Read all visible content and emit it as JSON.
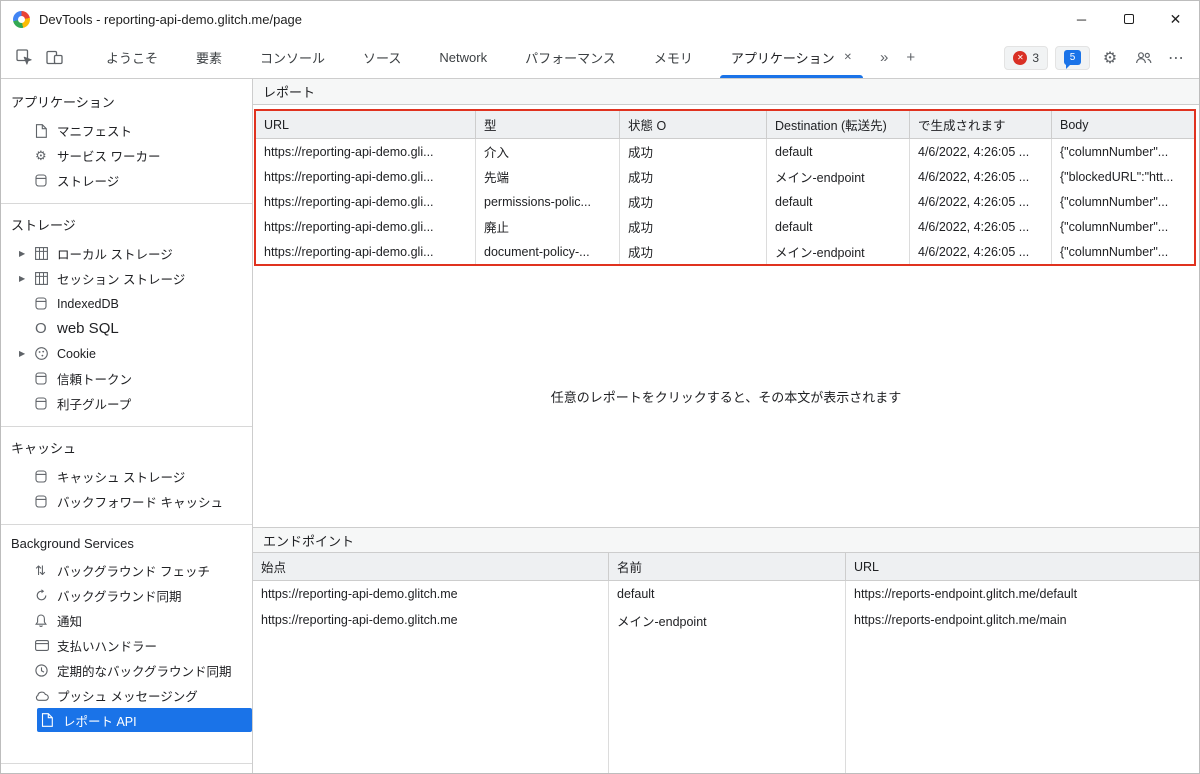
{
  "colors": {
    "selection_blue": "#1a73e8",
    "annotation_red": "#e0321f",
    "error_red": "#d93025"
  },
  "icons": {
    "expand_arrow": "▶",
    "gear": "⚙",
    "fetch": "⇅",
    "more_tabs": "»",
    "add_tab": "+",
    "overflow": "⋯",
    "tab_close": "✕",
    "minimize": "─",
    "window_close": "✕",
    "error_x": "✕",
    "web_sql_o": "O"
  },
  "titlebar": {
    "title": "DevTools - reporting-api-demo.glitch.me/page"
  },
  "toolbar": {
    "tabs": [
      {
        "label": "ようこそ"
      },
      {
        "label": "要素"
      },
      {
        "label": "コンソール"
      },
      {
        "label": "ソース"
      },
      {
        "label": "Network"
      },
      {
        "label": "パフォーマンス"
      },
      {
        "label": "メモリ"
      },
      {
        "label": "アプリケーション",
        "active": true
      }
    ],
    "error_count": "3",
    "issue_count": "5"
  },
  "sidebar": {
    "sections": [
      {
        "title": "アプリケーション",
        "items": [
          {
            "label": "マニフェスト",
            "icon": "document"
          },
          {
            "label": "サービス ワーカー",
            "icon": "gear"
          },
          {
            "label": "ストレージ",
            "icon": "storage"
          }
        ]
      },
      {
        "title": "ストレージ",
        "items": [
          {
            "label": "ローカル ストレージ",
            "icon": "table",
            "expandable": true
          },
          {
            "label": "セッション ストレージ",
            "icon": "table",
            "expandable": true
          },
          {
            "label": "IndexedDB",
            "icon": "storage"
          },
          {
            "label": "web SQL",
            "icon": "circle-o"
          },
          {
            "label": "Cookie",
            "icon": "cookie",
            "expandable": true
          },
          {
            "label": "信頼トークン",
            "icon": "storage"
          },
          {
            "label": "利子グループ",
            "icon": "storage"
          }
        ]
      },
      {
        "title": "キャッシュ",
        "items": [
          {
            "label": "キャッシュ ストレージ",
            "icon": "storage"
          },
          {
            "label": "バックフォワード キャッシュ",
            "icon": "storage"
          }
        ]
      },
      {
        "title": "Background Services",
        "items": [
          {
            "label": "バックグラウンド フェッチ",
            "icon": "fetch"
          },
          {
            "label": "バックグラウンド同期",
            "icon": "sync"
          },
          {
            "label": "通知",
            "icon": "bell"
          },
          {
            "label": "支払いハンドラー",
            "icon": "card"
          },
          {
            "label": "定期的なバックグラウンド同期",
            "icon": "clock"
          },
          {
            "label": "プッシュ メッセージング",
            "icon": "cloud"
          },
          {
            "label": "レポート API",
            "icon": "document",
            "selected": true
          }
        ]
      }
    ]
  },
  "reports": {
    "title": "レポート",
    "columns": [
      "URL",
      "型",
      "状態 O",
      "Destination (転送先)",
      "で生成されます",
      "Body"
    ],
    "rows": [
      [
        "https://reporting-api-demo.gli...",
        "介入",
        "成功",
        "default",
        "4/6/2022, 4:26:05 ...",
        "{\"columnNumber\"..."
      ],
      [
        "https://reporting-api-demo.gli...",
        "先端",
        "成功",
        "メイン-endpoint",
        "4/6/2022, 4:26:05 ...",
        "{\"blockedURL\":\"htt..."
      ],
      [
        "https://reporting-api-demo.gli...",
        "permissions-polic...",
        "成功",
        "default",
        "4/6/2022, 4:26:05 ...",
        "{\"columnNumber\"..."
      ],
      [
        "https://reporting-api-demo.gli...",
        "廃止",
        "成功",
        "default",
        "4/6/2022, 4:26:05 ...",
        "{\"columnNumber\"..."
      ],
      [
        "https://reporting-api-demo.gli...",
        "document-policy-...",
        "成功",
        "メイン-endpoint",
        "4/6/2022, 4:26:05 ...",
        "{\"columnNumber\"..."
      ]
    ],
    "hint": "任意のレポートをクリックすると、その本文が表示されます"
  },
  "endpoints": {
    "title": "エンドポイント",
    "columns": [
      "始点",
      "名前",
      "URL"
    ],
    "rows": [
      [
        "https://reporting-api-demo.glitch.me",
        "default",
        "https://reports-endpoint.glitch.me/default"
      ],
      [
        "https://reporting-api-demo.glitch.me",
        "メイン-endpoint",
        "https://reports-endpoint.glitch.me/main"
      ]
    ]
  }
}
